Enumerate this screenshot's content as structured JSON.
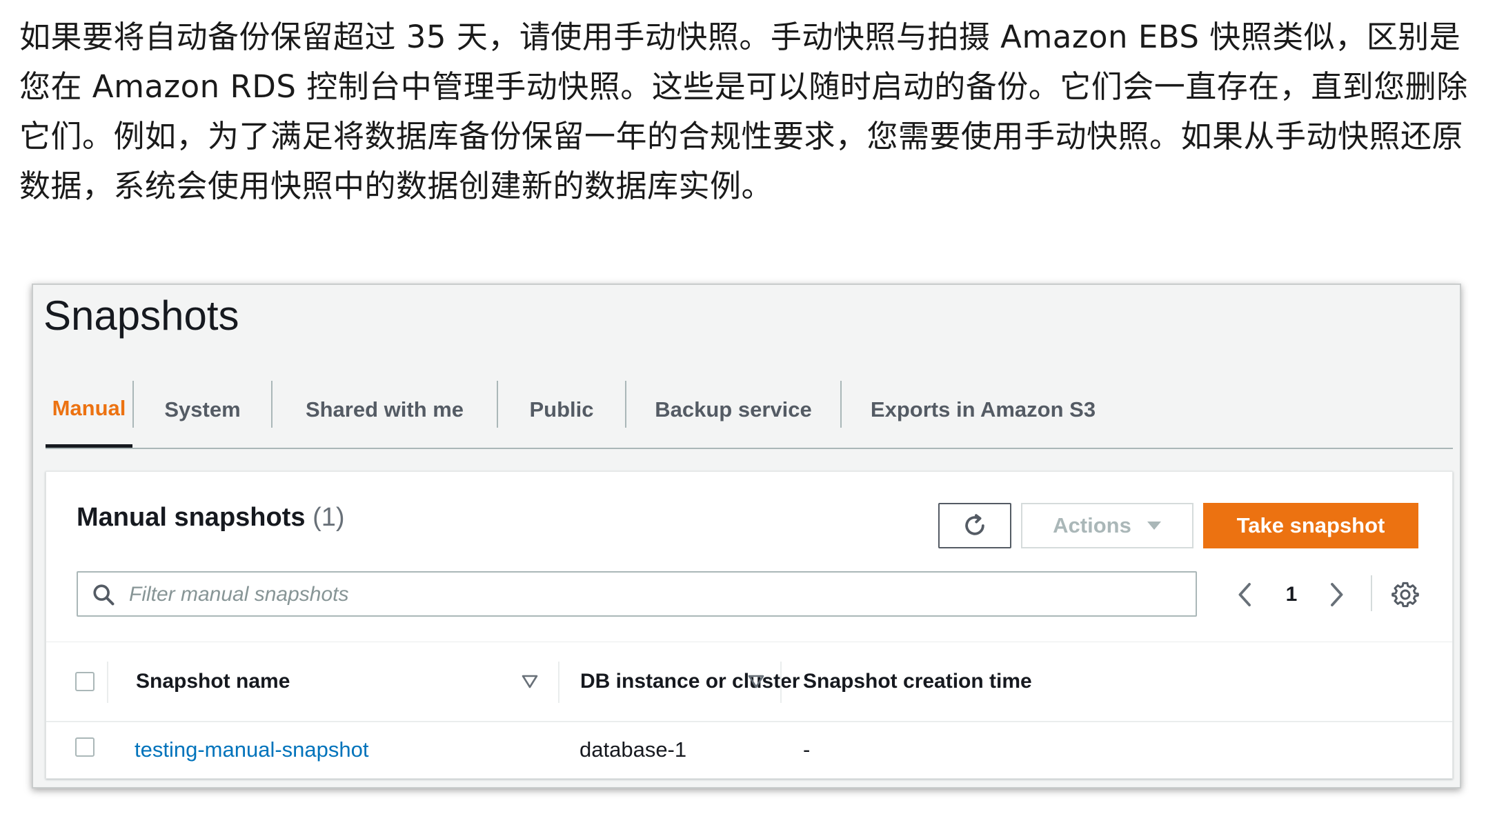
{
  "intro": {
    "text": "如果要将自动备份保留超过 35 天，请使用手动快照。手动快照与拍摄 Amazon EBS 快照类似，区别是您在 Amazon RDS 控制台中管理手动快照。这些是可以随时启动的备份。它们会一直存在，直到您删除它们。例如，为了满足将数据库备份保留一年的合规性要求，您需要使用手动快照。如果从手动快照还原数据，系统会使用快照中的数据创建新的数据库实例。"
  },
  "page": {
    "title": "Snapshots"
  },
  "tabs": [
    {
      "label": "Manual",
      "active": true
    },
    {
      "label": "System",
      "active": false
    },
    {
      "label": "Shared with me",
      "active": false
    },
    {
      "label": "Public",
      "active": false
    },
    {
      "label": "Backup service",
      "active": false
    },
    {
      "label": "Exports in Amazon S3",
      "active": false
    }
  ],
  "container": {
    "title": "Manual snapshots",
    "count": "(1)",
    "refresh_icon": "refresh-icon",
    "actions_label": "Actions",
    "actions_icon": "caret-down-icon",
    "primary_label": "Take snapshot",
    "search": {
      "placeholder": "Filter manual snapshots",
      "value": "",
      "icon": "search-icon"
    },
    "pagination": {
      "current_page": "1",
      "prev_icon": "chevron-left-icon",
      "next_icon": "chevron-right-icon"
    },
    "settings_icon": "gear-icon"
  },
  "table": {
    "columns": [
      {
        "label": "Snapshot name",
        "sortable": true
      },
      {
        "label": "DB instance or cluster",
        "sortable": true
      },
      {
        "label": "Snapshot creation time",
        "sortable": false
      }
    ],
    "rows": [
      {
        "name": "testing-manual-snapshot",
        "instance": "database-1",
        "created": "-"
      }
    ]
  },
  "colors": {
    "accent": "#ec7211",
    "link": "#0073bb",
    "text": "#16191f",
    "muted": "#545b64",
    "border": "#aab7b8"
  }
}
